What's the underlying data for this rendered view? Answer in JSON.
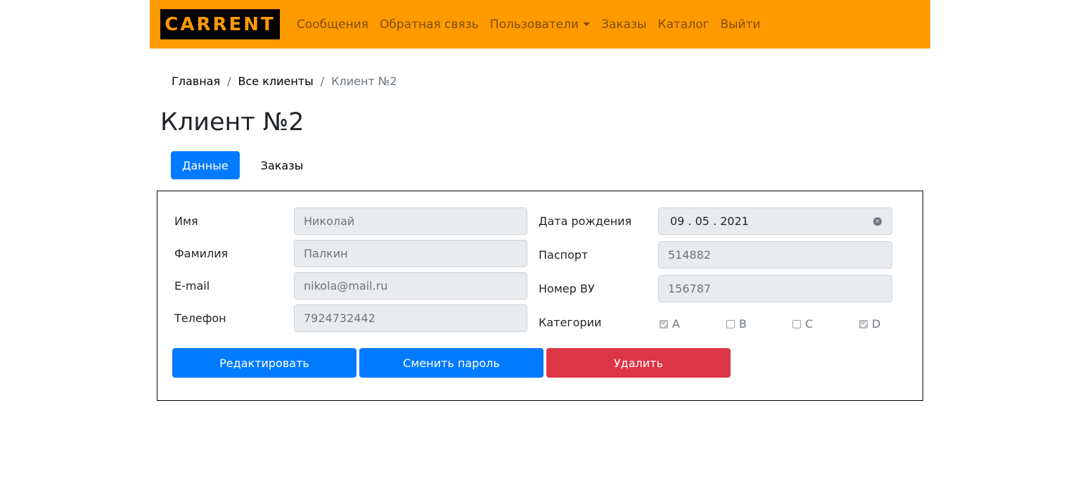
{
  "navbar": {
    "logo_text": "CARRENT",
    "links": {
      "messages": "Сообщения",
      "feedback": "Обратная связь",
      "users": "Пользователи",
      "orders": "Заказы",
      "catalog": "Каталог",
      "logout": "Выйти"
    },
    "accent_color": "#ff9a00"
  },
  "breadcrumb": {
    "home": "Главная",
    "all_clients": "Все клиенты",
    "current": "Клиент №2",
    "separator": "/"
  },
  "page": {
    "title": "Клиент №2"
  },
  "tabs": {
    "data": "Данные",
    "orders": "Заказы",
    "active": "data"
  },
  "form": {
    "first_name": {
      "label": "Имя",
      "value": "Николай"
    },
    "last_name": {
      "label": "Фамилия",
      "value": "Палкин"
    },
    "email": {
      "label": "E-mail",
      "value": "nikola@mail.ru"
    },
    "phone": {
      "label": "Телефон",
      "value": "7924732442"
    },
    "birth_date": {
      "label": "Дата рождения",
      "value": "09 . 05 . 2021"
    },
    "passport": {
      "label": "Паспорт",
      "value": "514882"
    },
    "license": {
      "label": "Номер ВУ",
      "value": "156787"
    },
    "categories": {
      "label": "Категории",
      "items": [
        {
          "name": "A",
          "checked": true
        },
        {
          "name": "B",
          "checked": false
        },
        {
          "name": "C",
          "checked": false
        },
        {
          "name": "D",
          "checked": true
        }
      ]
    }
  },
  "actions": {
    "edit": "Редактировать",
    "change_password": "Сменить пароль",
    "delete": "Удалить"
  }
}
